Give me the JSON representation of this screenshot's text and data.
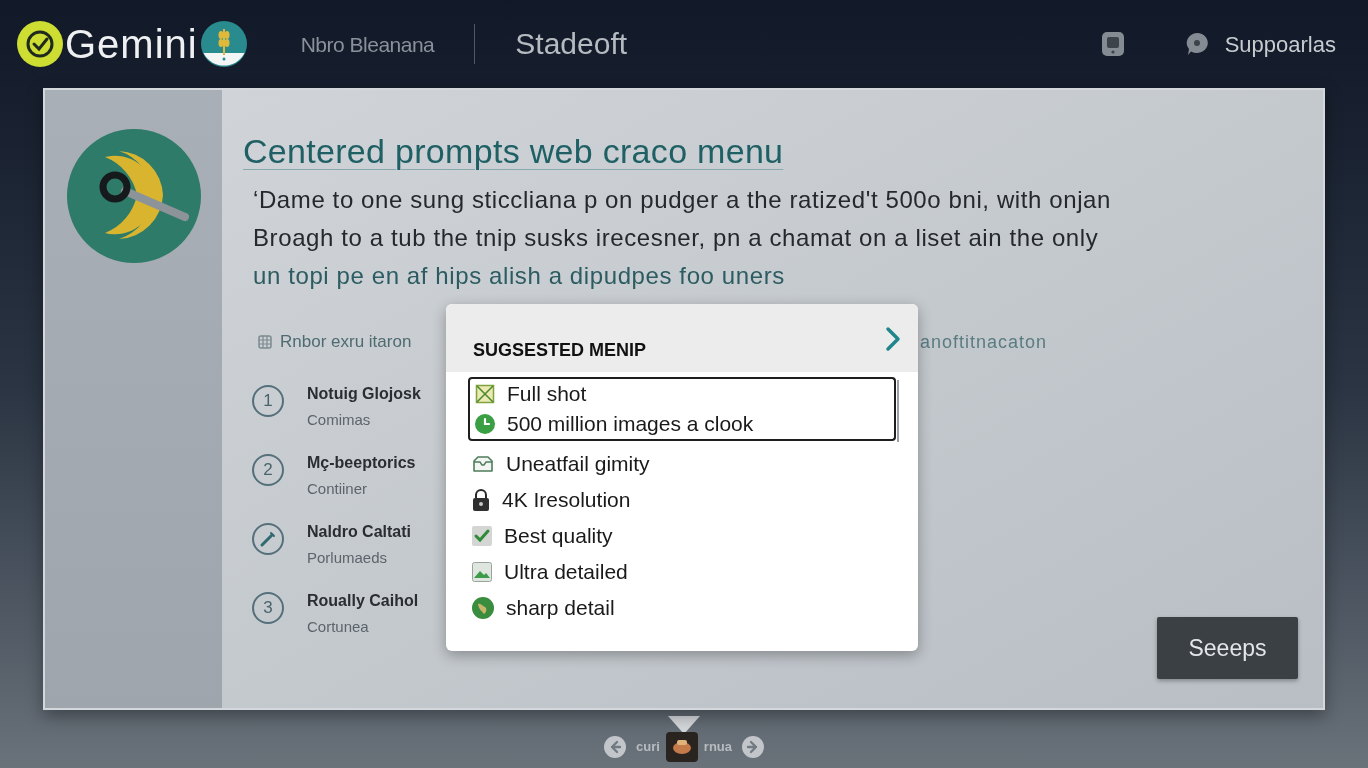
{
  "header": {
    "brand": "Gemini",
    "nav": [
      {
        "label": "Nbro Bleanana",
        "selected": false
      },
      {
        "label": "Stadeoft",
        "selected": true
      }
    ],
    "support": "Suppoarlas"
  },
  "card": {
    "title": "Centered prompts web craco menu",
    "description_lines": [
      {
        "text": "‘Dame to one sung sticcliana p on pudger a the ratized't 500o bni, with onjan",
        "kind": "body"
      },
      {
        "text": "Broagh to a tub the tnip susks irecesner, pn a chamat on a liset ain the only",
        "kind": "body"
      },
      {
        "text": "un topi pe en af hips alish a dipudpes foo uners",
        "kind": "accent"
      }
    ],
    "section_label": "Rnbor exru itaron",
    "section_label_right": "anoftitnacaton",
    "steps": [
      {
        "kind": "number",
        "number": "1",
        "title": "Notuig Glojosk",
        "subtitle": "Comimas"
      },
      {
        "kind": "number",
        "number": "2",
        "title": "Mç-beeptorics",
        "subtitle": "Contiiner"
      },
      {
        "kind": "icon",
        "title": "Naldro Caltati",
        "subtitle": "Porlumaeds"
      },
      {
        "kind": "number",
        "number": "3",
        "title": "Roually Caihol",
        "subtitle": "Cortunea"
      }
    ],
    "action_button": "Seeeps"
  },
  "menu": {
    "title": "SUGSESTED MENIP",
    "items": [
      {
        "label": "Full shot",
        "kind": "frame",
        "selected": true
      },
      {
        "label": "500 million images a clook",
        "kind": "clock",
        "selected": true
      },
      {
        "label": "Uneatfail gimity",
        "kind": "tray",
        "selected": false
      },
      {
        "label": "4K Iresolution",
        "kind": "lock",
        "selected": false
      },
      {
        "label": "Best quality",
        "kind": "check",
        "selected": false
      },
      {
        "label": "Ultra detailed",
        "kind": "image",
        "selected": false
      },
      {
        "label": "sharp detail",
        "kind": "globe",
        "selected": false
      }
    ]
  },
  "pagination": {
    "previous": "curi",
    "next": "rnua"
  }
}
